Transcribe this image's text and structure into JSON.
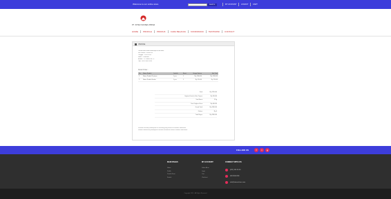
{
  "topbar": {
    "welcome": "Welcome to our online store",
    "search_placeholder": "",
    "search_button": "SEARCH",
    "links": [
      "MY ACCOUNT",
      "LOGOUT",
      "CART"
    ]
  },
  "brand": {
    "name": "PT. INTAN SUKSES PRIMA",
    "logo_color": "#d42a2a"
  },
  "nav": [
    "HOME",
    "PROFILE",
    "PRODUK",
    "CARA BELANJA",
    "KONFIRMASI",
    "TESTIMONI",
    "CONTACT"
  ],
  "panel": {
    "title": "INVOICE",
    "info_lines": [
      "Terima kasih telah berbelanja di toko kami",
      "No. Invoice : INV-00123",
      "Tanggal : 12-05-2014",
      "Nama : Customer",
      "Alamat : Jl. Contoh No. 12",
      "Telp : 0812-3456-7890"
    ],
    "section_title": "Detail Order :",
    "table": {
      "headers": [
        "No",
        "Nama Produk",
        "Jumlah",
        "Berat",
        "Harga Satuan",
        "Sub Total"
      ],
      "rows": [
        [
          "1",
          "Nama Produk Pertama",
          "1 pcs",
          "1",
          "Rp 150.000",
          "Rp 150.000"
        ],
        [
          "2",
          "Nama Produk Kedua",
          "1 pcs",
          "1",
          "Rp 75.000",
          "Rp 75.000"
        ]
      ]
    },
    "summary": [
      {
        "label": "Total :",
        "value": "Rp 225.000"
      },
      {
        "label": "Ongkos Kirim ke Kota Tujuan :",
        "value": "Rp 20.000"
      },
      {
        "label": "Total Berat :",
        "value": "2 Kg"
      },
      {
        "label": "Total Ongkos Kirim :",
        "value": "Rp 40.000"
      },
      {
        "label": "Grand Total :",
        "value": "Rp 265.000"
      },
      {
        "label": "Diskon :",
        "value": "Rp 0"
      },
      {
        "label": "Total Bayar :",
        "value": "Rp 265.000"
      }
    ],
    "notes": [
      "Silahkan lakukan pembayaran ke rekening yang tertera di halaman konfirmasi.",
      "Setelah melakukan pembayaran silahkan konfirmasi melalui halaman konfirmasi."
    ]
  },
  "follow": {
    "label": "FOLLOW US",
    "icons": [
      "facebook-icon",
      "twitter-icon",
      "google-plus-icon"
    ],
    "glyphs": [
      "f",
      "t",
      "g"
    ],
    "accent": "#e32c5a"
  },
  "footer": {
    "col1": {
      "heading": "MAIN PAGES",
      "links": [
        "Home",
        "Profile",
        "Produk Kami",
        "Kontak"
      ]
    },
    "col2": {
      "heading": "MY ACCOUNT",
      "links": [
        "Daftar Akun",
        "Login",
        "Cart",
        "Checkout"
      ]
    },
    "col3": {
      "heading": "CONNECT WITH US",
      "items": [
        "(021) 555 55 55",
        "08123456789",
        "info@intansukses.com"
      ]
    },
    "copyright": "Copyright 2014 - All Rights Reserved"
  },
  "colors": {
    "primary_blue": "#3d3ddb",
    "footer_dark": "#2f2f2f",
    "nav_red": "#c33333"
  }
}
